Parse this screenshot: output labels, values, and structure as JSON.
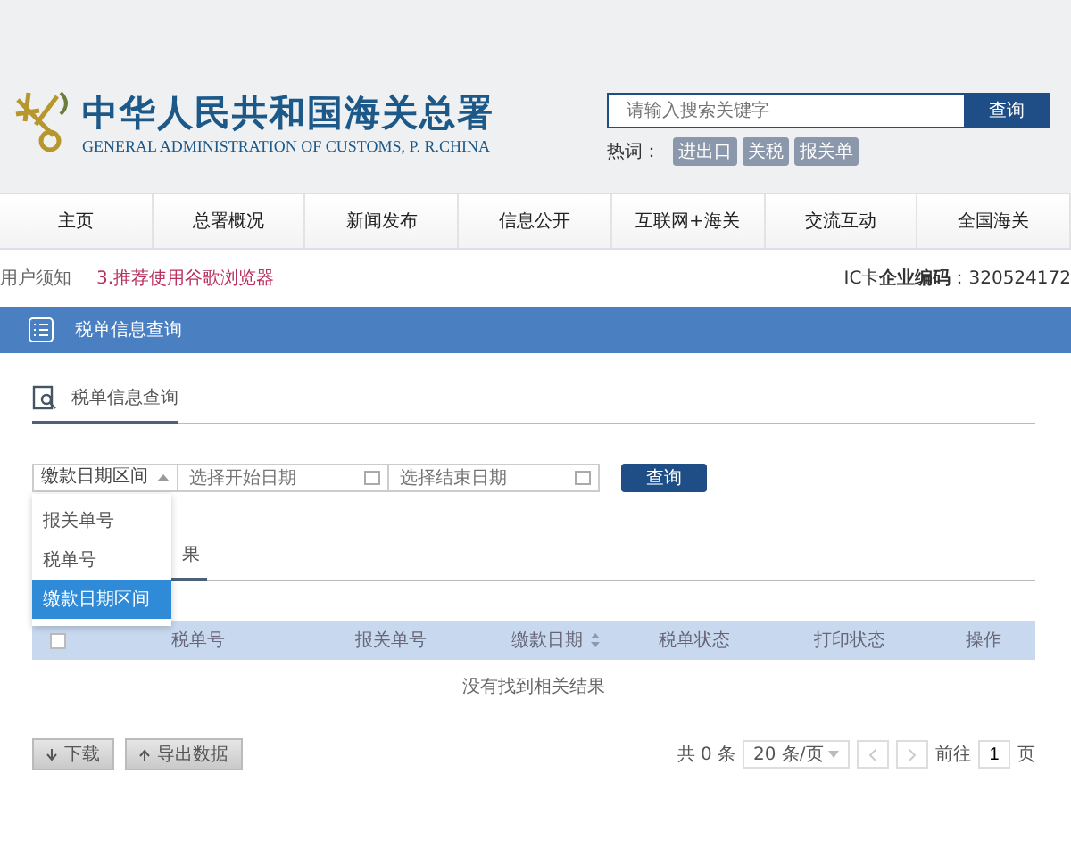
{
  "header": {
    "title": "中华人民共和国海关总署",
    "subtitle": "GENERAL ADMINISTRATION OF CUSTOMS, P. R.CHINA",
    "search": {
      "placeholder": "请输入搜索关键字",
      "button": "查询"
    },
    "hot_label": "热词：",
    "hot_words": [
      "进出口",
      "关税",
      "报关单"
    ]
  },
  "nav": [
    {
      "label": "主页",
      "selected": false
    },
    {
      "label": "总署概况",
      "selected": false
    },
    {
      "label": "新闻发布",
      "selected": false
    },
    {
      "label": "信息公开",
      "selected": false
    },
    {
      "label": "互联网+海关",
      "selected": false
    },
    {
      "label": "交流互动",
      "selected": false
    },
    {
      "label": "全国海关",
      "selected": false
    }
  ],
  "notice": {
    "label": "用户须知",
    "message": "3.推荐使用谷歌浏览器",
    "ic": "IC卡**企业编码**：320524172"
  },
  "section_title": "税单信息查询",
  "sub_tab": "税单信息查询",
  "form": {
    "select": "缴款日期区间",
    "start_placeholder": "选择开始日期",
    "end_placeholder": "选择结束日期",
    "button": "查询"
  },
  "dropdown": [
    {
      "label": "报关单号",
      "selected": false
    },
    {
      "label": "税单号",
      "selected": false
    },
    {
      "label": "缴款日期区间",
      "selected": true
    }
  ],
  "result_tab": "果",
  "table": {
    "select_all_checked": false,
    "columns": [
      "税单号",
      "报关单号",
      "缴款日期",
      "税单状态",
      "打印状态",
      "操作"
    ],
    "empty": "没有找到相关结果"
  },
  "actions": [
    "下载",
    "导出数据"
  ],
  "pagination": {
    "total": "共 0 条",
    "page_size": "20 条/页",
    "goto": "前往",
    "page": "1",
    "unit": "页"
  }
}
